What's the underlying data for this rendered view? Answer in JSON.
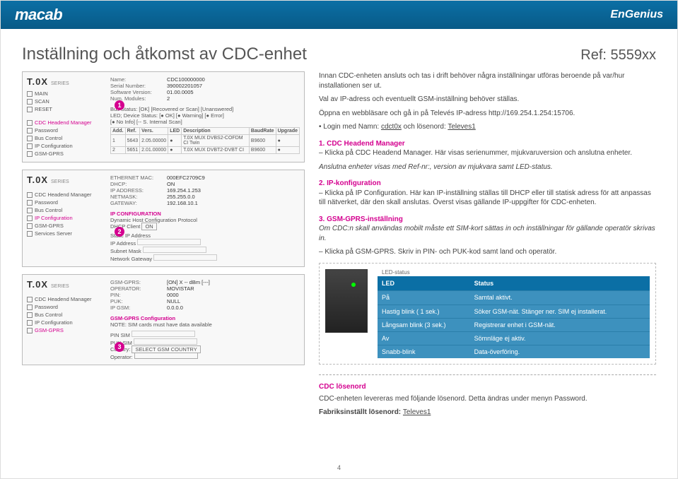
{
  "header": {
    "brand_left": "macab",
    "brand_right": "EnGenius"
  },
  "title": "Inställning och åtkomst av CDC-enhet",
  "ref": "Ref: 5559xx",
  "screenshots": {
    "tox_label": "T.0X",
    "series_label": "SERIES",
    "top_menu": [
      "MAIN",
      "SCAN",
      "RESET"
    ],
    "info_block": [
      {
        "k": "Name:",
        "v": "CDC100000000"
      },
      {
        "k": "Serial Number:",
        "v": "390002201057"
      },
      {
        "k": "Software Version:",
        "v": "01.00.0005"
      },
      {
        "k": "Num. Modules:",
        "v": "2"
      }
    ],
    "s1": {
      "callout": "1",
      "menu": [
        "CDC Headend Manager",
        "Password",
        "Bus Control",
        "IP Configuration",
        "GSM-GPRS"
      ],
      "bus_status": "Bus Status: [OK] [Recovered or Scan] [Unanswered]",
      "led_status": "LED; Device Status: [● OK] [● Warning] [● Error]",
      "led_no_info": "[● No Info] [-- S. Internal Scan]",
      "table": {
        "head": [
          "Add.",
          "Ref.",
          "Vers.",
          "LED",
          "Description",
          "BaudRate",
          "Upgrade"
        ],
        "rows": [
          [
            "1",
            "5643",
            "2.05.00000",
            "●",
            "T.0X MUX DVBS2-COFDM CI Twin",
            "B9600",
            "●"
          ],
          [
            "2",
            "5651",
            "2.01.00000",
            "●",
            "T.0X MUX DVBT2-DVBT CI",
            "B9600",
            "●"
          ]
        ]
      }
    },
    "s2": {
      "callout": "2",
      "menu": [
        "CDC Headend Manager",
        "Password",
        "Bus Control",
        "IP Configuration",
        "GSM-GPRS",
        "Services Server"
      ],
      "title": "IP CONFIGURATION",
      "subtitle": "Dynamic Host Configuration Protocol",
      "dhcp_label": "DHCP Client",
      "dhcp_value": "ON",
      "static_label": "Static IP Address",
      "fields": [
        "IP Address",
        "Subnet Mask",
        "Network Gateway"
      ],
      "net_block": [
        {
          "k": "ETHERNET MAC:",
          "v": "000EFC2709C9"
        },
        {
          "k": "DHCP:",
          "v": "ON"
        },
        {
          "k": "IP ADDRESS:",
          "v": "169.254.1.253"
        },
        {
          "k": "NETMASK:",
          "v": "255.255.0.0"
        },
        {
          "k": "GATEWAY:",
          "v": "192.168.10.1"
        }
      ]
    },
    "s3": {
      "callout": "3",
      "menu": [
        "CDC Headend Manager",
        "Password",
        "Bus Control",
        "IP Configuration",
        "GSM-GPRS"
      ],
      "title": "GSM-GPRS Configuration",
      "note": "NOTE: SIM cards must have data available",
      "gsm_block": [
        {
          "k": "GSM-GPRS:",
          "v": "[ON]   X   -- dBm   [---]"
        },
        {
          "k": "OPERATOR:",
          "v": "MOVISTAR"
        },
        {
          "k": "PIN:",
          "v": "0000"
        },
        {
          "k": "PUK:",
          "v": "NULL"
        },
        {
          "k": "IP GSM:",
          "v": "0.0.0.0"
        }
      ],
      "fields": [
        {
          "label": "PIN SIM",
          "val": ""
        },
        {
          "label": "PUK SIM",
          "val": ""
        },
        {
          "label": "Country:",
          "val": "SELECT GSM COUNTRY"
        },
        {
          "label": "Operator:",
          "val": ""
        }
      ]
    }
  },
  "intro": [
    "Innan CDC-enheten ansluts och tas i drift behöver några inställningar utföras beroende på var/hur installationen ser ut.",
    "Val av IP-adress och eventuellt GSM-inställning behöver ställas."
  ],
  "open_line": "Öppna en webbläsare och gå in på Televés IP-adress http://169.254.1.254:15706.",
  "login_line_prefix": "• Login med Namn: ",
  "login_user": "cdct0x",
  "login_mid": " och lösenord: ",
  "login_pw": "Televes1",
  "sec1_head": "1. CDC Headend Manager",
  "sec1_l1": "– Klicka på CDC Headend Manager. Här visas serienummer, mjukvaruversion och anslutna enheter.",
  "sec1_l2": "Anslutna enheter visas med Ref-nr:, version av mjukvara samt LED-status.",
  "sec2_head": "2. IP-konfiguration",
  "sec2_l1": "– Klicka på IP Configuration. Här kan IP-inställning ställas till DHCP eller till statisk adress för att anpassas till nätverket, där den skall anslutas. Överst visas gällande IP-uppgifter för CDC-enheten.",
  "sec3_head": "3. GSM-GPRS-inställning",
  "sec3_l1": "Om CDC:n skall användas mobilt måste ett SIM-kort sättas in och inställningar för gällande operatör skrivas in.",
  "sec3_l2": "– Klicka på GSM-GPRS. Skriv in PIN- och PUK-kod samt land och operatör.",
  "led_label": "LED-status",
  "led_table": {
    "head": [
      "LED",
      "Status"
    ],
    "rows": [
      [
        "På",
        "Samtal aktivt."
      ],
      [
        "Hastig blink ( 1 sek.)",
        "Söker GSM-nät. Stänger ner. SIM ej installerat."
      ],
      [
        "Långsam blink (3 sek.)",
        "Registrerar enhet i GSM-nät."
      ],
      [
        "Av",
        "Sömnläge ej aktiv."
      ],
      [
        "Snabb-blink",
        "Data-överföring."
      ]
    ]
  },
  "pw_head": "CDC lösenord",
  "pw_line": "CDC-enheten levereras med följande lösenord. Detta ändras under menyn Password.",
  "pw_factory_prefix": "Fabriksinställt lösenord: ",
  "pw_factory": "Televes1",
  "page_num": "4"
}
